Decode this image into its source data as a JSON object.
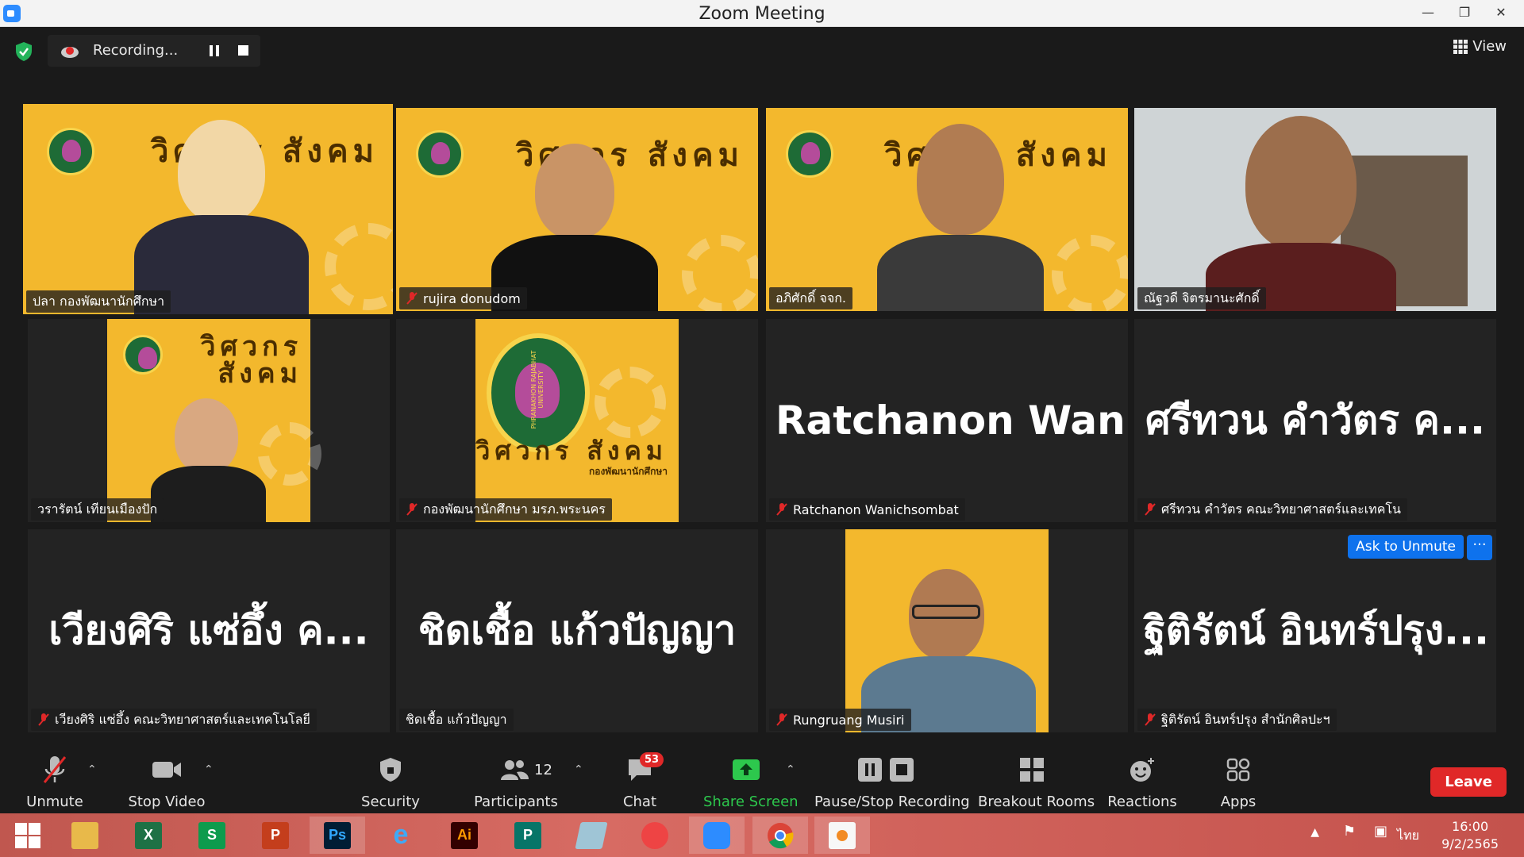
{
  "window": {
    "title": "Zoom Meeting"
  },
  "topbar": {
    "recording_label": "Recording...",
    "view_label": "View"
  },
  "tiles": [
    {
      "name": "ปลา กองพัฒนานักศึกษา",
      "banner": "วิศวกร สังคม"
    },
    {
      "name": "rujira donudom",
      "banner": "วิศวกร สังคม"
    },
    {
      "name": "อภิศักดิ์ จจก.",
      "banner": "วิศวกร สังคม"
    },
    {
      "name": "ณัฐวดี จิตรมานะศักดิ์"
    },
    {
      "name": "วรารัตน์ เทียนเมืองปัก",
      "banner": "วิศวกร สังคม"
    },
    {
      "name": "กองพัฒนานักศึกษา มรภ.พระนคร",
      "banner": "วิศวกร สังคม",
      "seal_text": "PHRANAKHON RAJABHAT UNIVERSITY",
      "sub_text": "กองพัฒนานักศึกษา"
    },
    {
      "name": "Ratchanon Wanichsombat",
      "big": "Ratchanon Wani..."
    },
    {
      "name": "ศรีทวน คำวัตร คณะวิทยาศาสตร์และเทคโน",
      "big": "ศรีทวน คำวัตร ค..."
    },
    {
      "name": "เวียงศิริ แซ่อึ้ง คณะวิทยาศาสตร์และเทคโนโลยี",
      "big": "เวียงศิริ แซ่อึ้ง ค..."
    },
    {
      "name": "ชิดเชื้อ แก้วปัญญา",
      "big": "ชิดเชื้อ แก้วปัญญา"
    },
    {
      "name": "Rungruang Musiri"
    },
    {
      "name": "ฐิติรัตน์ อินทร์ปรุง สำนักศิลปะฯ",
      "big": "ฐิติรัตน์ อินทร์ปรุง...",
      "ask_unmute": "Ask to Unmute",
      "more": "···"
    }
  ],
  "toolbar": {
    "unmute": "Unmute",
    "stop_video": "Stop Video",
    "security": "Security",
    "participants": "Participants",
    "participants_count": "12",
    "chat": "Chat",
    "chat_badge": "53",
    "share_screen": "Share Screen",
    "pause_stop_recording": "Pause/Stop Recording",
    "breakout_rooms": "Breakout Rooms",
    "reactions": "Reactions",
    "apps": "Apps",
    "leave": "Leave"
  },
  "taskbar": {
    "apps": [
      "Start",
      "File Explorer",
      "Excel",
      "Publisher",
      "PowerPoint",
      "Photoshop",
      "Internet Explorer",
      "Illustrator",
      "Project",
      "Notes",
      "PhotoScape",
      "Zoom",
      "Chrome",
      "Paint"
    ],
    "excel": "X",
    "store": "S",
    "ppt": "P",
    "ps": "Ps",
    "ai": "Ai",
    "pub": "P",
    "language": "ไทย",
    "time": "16:00",
    "date": "9/2/2565"
  },
  "colors": {
    "accent": "#0e72ed",
    "share": "#2dc84d",
    "leave": "#e02828",
    "active_speaker": "#c5e86c"
  }
}
